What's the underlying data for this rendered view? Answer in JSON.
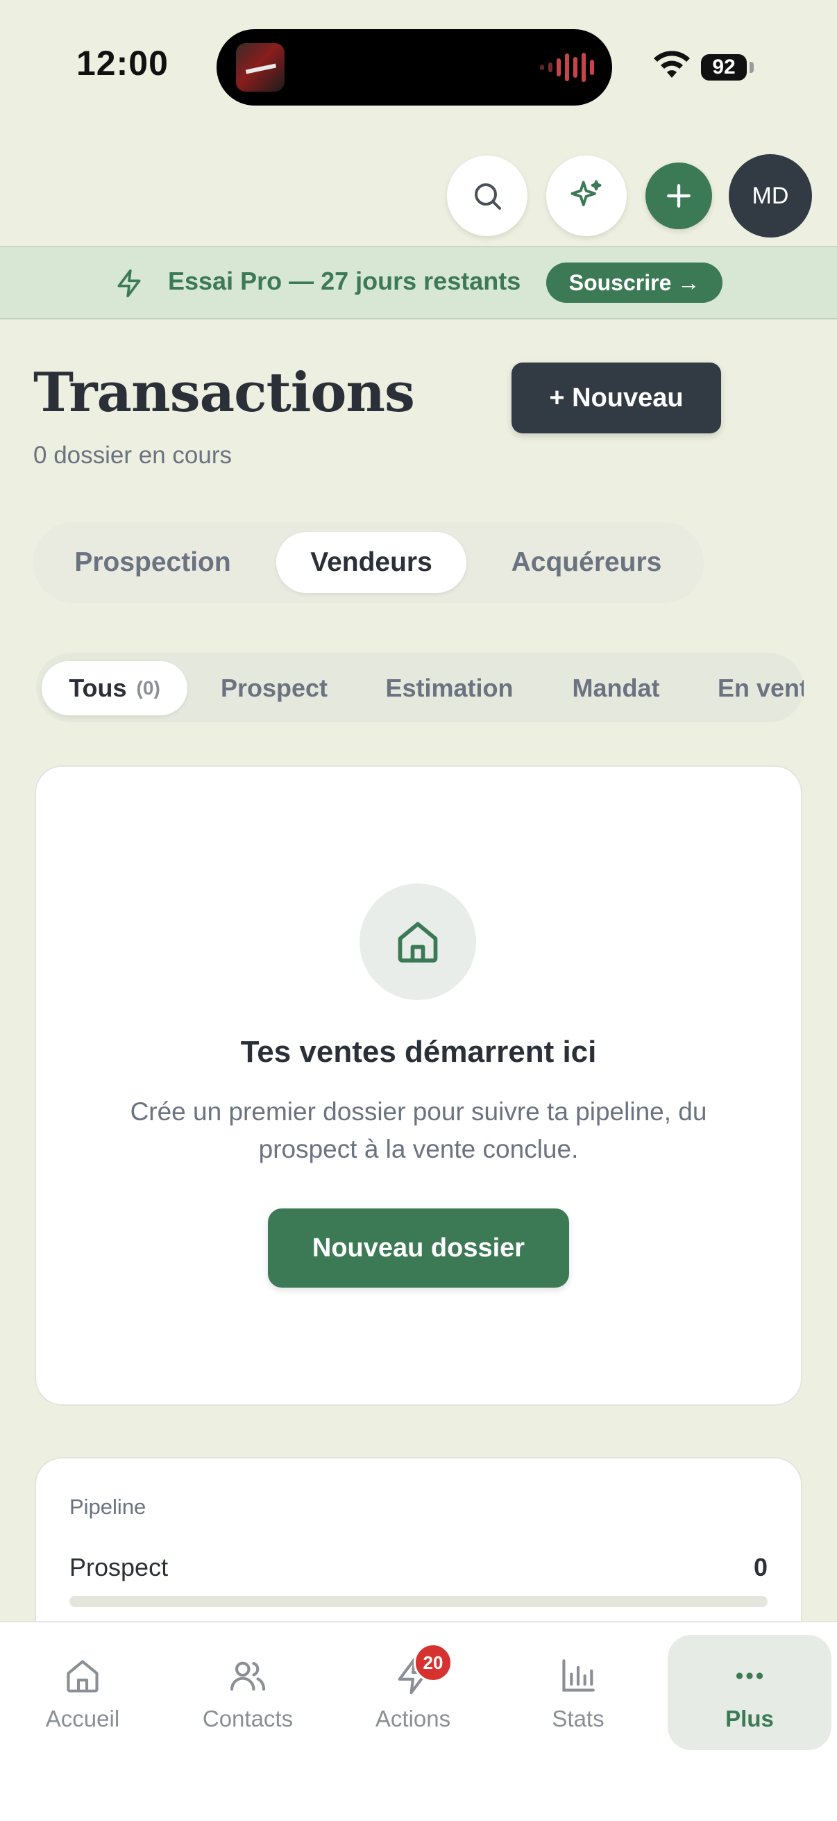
{
  "status_bar": {
    "time": "12:00",
    "battery": "92"
  },
  "header": {
    "avatar_initials": "MD",
    "icons": [
      "search-icon",
      "sparkles-icon",
      "plus-icon"
    ]
  },
  "trial_banner": {
    "text": "Essai Pro — 27 jours restants",
    "cta": "Souscrire →"
  },
  "page": {
    "title": "Transactions",
    "subtitle": "0 dossier en cours",
    "new_button": "+ Nouveau"
  },
  "segments": [
    {
      "label": "Prospection",
      "active": false
    },
    {
      "label": "Vendeurs",
      "active": true
    },
    {
      "label": "Acquéreurs",
      "active": false
    }
  ],
  "filters": [
    {
      "label": "Tous",
      "count": "(0)",
      "active": true
    },
    {
      "label": "Prospect"
    },
    {
      "label": "Estimation"
    },
    {
      "label": "Mandat"
    },
    {
      "label": "En vente"
    }
  ],
  "empty_state": {
    "icon": "house-icon",
    "title": "Tes ventes démarrent ici",
    "description": "Crée un premier dossier pour suivre ta pipeline, du prospect à la vente conclue.",
    "cta": "Nouveau dossier"
  },
  "pipeline": {
    "title": "Pipeline",
    "rows": [
      {
        "label": "Prospect",
        "value": "0",
        "fraction": 0
      }
    ]
  },
  "bottom_nav": [
    {
      "label": "Accueil",
      "icon": "home-icon"
    },
    {
      "label": "Contacts",
      "icon": "users-icon"
    },
    {
      "label": "Actions",
      "icon": "bolt-icon",
      "badge": "20"
    },
    {
      "label": "Stats",
      "icon": "bar-chart-icon"
    },
    {
      "label": "Plus",
      "icon": "more-dots-icon",
      "active": true
    }
  ],
  "colors": {
    "background": "#edefe0",
    "brand_green": "#3c7a55",
    "dark": "#323a44",
    "badge_red": "#d6322f"
  }
}
